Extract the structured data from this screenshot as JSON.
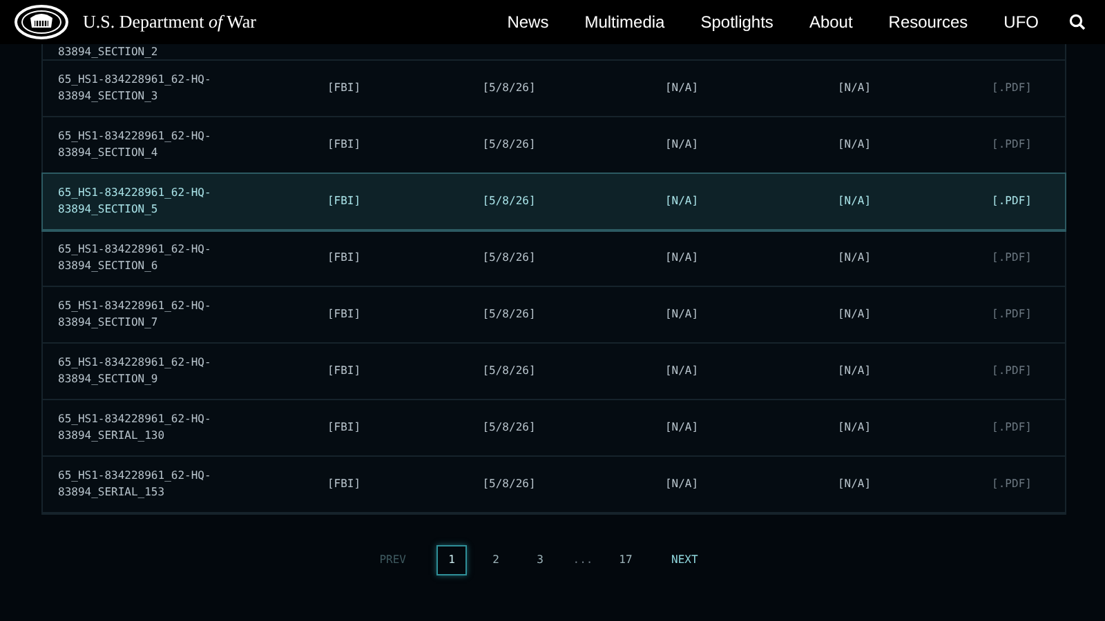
{
  "header": {
    "title_prefix": "U.S. Department ",
    "title_italic": "of",
    "title_suffix": " War",
    "nav": [
      "News",
      "Multimedia",
      "Spotlights",
      "About",
      "Resources",
      "UFO"
    ]
  },
  "table": {
    "partial_row": {
      "name_line_2": "83894_SECTION_2"
    },
    "rows": [
      {
        "name": "65_HS1-834228961_62-HQ-83894_SECTION_3",
        "agency": "[FBI]",
        "date": "[5/8/26]",
        "column_4": "[N/A]",
        "column_5": "[N/A]",
        "type": "[.PDF]",
        "selected": false
      },
      {
        "name": "65_HS1-834228961_62-HQ-83894_SECTION_4",
        "agency": "[FBI]",
        "date": "[5/8/26]",
        "column_4": "[N/A]",
        "column_5": "[N/A]",
        "type": "[.PDF]",
        "selected": false
      },
      {
        "name": "65_HS1-834228961_62-HQ-83894_SECTION_5",
        "agency": "[FBI]",
        "date": "[5/8/26]",
        "column_4": "[N/A]",
        "column_5": "[N/A]",
        "type": "[.PDF]",
        "selected": true
      },
      {
        "name": "65_HS1-834228961_62-HQ-83894_SECTION_6",
        "agency": "[FBI]",
        "date": "[5/8/26]",
        "column_4": "[N/A]",
        "column_5": "[N/A]",
        "type": "[.PDF]",
        "selected": false
      },
      {
        "name": "65_HS1-834228961_62-HQ-83894_SECTION_7",
        "agency": "[FBI]",
        "date": "[5/8/26]",
        "column_4": "[N/A]",
        "column_5": "[N/A]",
        "type": "[.PDF]",
        "selected": false
      },
      {
        "name": "65_HS1-834228961_62-HQ-83894_SECTION_9",
        "agency": "[FBI]",
        "date": "[5/8/26]",
        "column_4": "[N/A]",
        "column_5": "[N/A]",
        "type": "[.PDF]",
        "selected": false
      },
      {
        "name": "65_HS1-834228961_62-HQ-83894_SERIAL_130",
        "agency": "[FBI]",
        "date": "[5/8/26]",
        "column_4": "[N/A]",
        "column_5": "[N/A]",
        "type": "[.PDF]",
        "selected": false
      },
      {
        "name": "65_HS1-834228961_62-HQ-83894_SERIAL_153",
        "agency": "[FBI]",
        "date": "[5/8/26]",
        "column_4": "[N/A]",
        "column_5": "[N/A]",
        "type": "[.PDF]",
        "selected": false
      }
    ]
  },
  "pagination": {
    "prev": {
      "label": "PREV",
      "disabled": true
    },
    "pages": [
      {
        "kind": "page",
        "label": "1",
        "selected": true
      },
      {
        "kind": "page",
        "label": "2",
        "selected": false
      },
      {
        "kind": "page",
        "label": "3",
        "selected": false
      },
      {
        "kind": "ellipsis",
        "label": "..."
      },
      {
        "kind": "page",
        "label": "17",
        "selected": false
      }
    ],
    "next": {
      "label": "NEXT",
      "disabled": false
    }
  }
}
